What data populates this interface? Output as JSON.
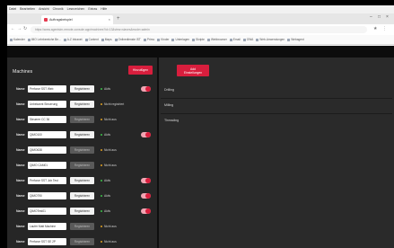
{
  "browser": {
    "menu": [
      "Datei",
      "Bearbeiten",
      "Ansicht",
      "Chronik",
      "Lesezeichen",
      "Extras",
      "Hilfe"
    ],
    "tab_title": "Auftragsbeispiel",
    "new_tab": "+",
    "close": "×",
    "window_controls": [
      "–",
      "□",
      "×"
    ],
    "url": "https://www.agentsim-remote-console.app/machines?id=13&view=slaves&mode=admin",
    "bookmarks": [
      "Kalender",
      "IMO Lehrbereiche Be...",
      "A-Z Intranet",
      "Content",
      "Maps",
      "Onlinedienste IST",
      "Primo",
      "Kinder",
      "Unterlagen",
      "Skripte",
      "Webbrowser",
      "Email",
      "OWA",
      "Web-Anwendungen",
      "Webagent"
    ]
  },
  "machines": {
    "title": "Machines",
    "add_button": "Hinzufügen",
    "label": "Name",
    "rows": [
      {
        "name": "Perforce SST Web",
        "register": "Registrieren",
        "register_state": "active",
        "status": "Aktiv",
        "status_color": "#3cc24a",
        "toggle": true
      },
      {
        "name": "Unbekannt Steuerung",
        "register": "Registrieren",
        "register_state": "active",
        "status": "Nicht registriert",
        "status_color": "#e0a020",
        "toggle": false
      },
      {
        "name": "Steuerer CC 36",
        "register": "Registrieren",
        "register_state": "disabled",
        "status": "Nicht aus",
        "status_color": "#e0a020",
        "toggle": false
      },
      {
        "name": "QIMO100",
        "register": "Registrieren",
        "register_state": "active",
        "status": "Aktiv",
        "status_color": "#3cc24a",
        "toggle": true
      },
      {
        "name": "QIMO638",
        "register": "Registrieren",
        "register_state": "disabled",
        "status": "Nicht aus",
        "status_color": "#e0a020",
        "toggle": false
      },
      {
        "name": "QIMO CAM01",
        "register": "Registrieren",
        "register_state": "disabled",
        "status": "Nicht aus",
        "status_color": "#e0a020",
        "toggle": false
      },
      {
        "name": "Perforce SST Job Test",
        "register": "Registrieren",
        "register_state": "active",
        "status": "Aktiv",
        "status_color": "#3cc24a",
        "toggle": true
      },
      {
        "name": "QIMO790",
        "register": "Registrieren",
        "register_state": "active",
        "status": "Aktiv",
        "status_color": "#3cc24a",
        "toggle": true
      },
      {
        "name": "QIMOTest01",
        "register": "Registrieren",
        "register_state": "active",
        "status": "Aktiv",
        "status_color": "#3cc24a",
        "toggle": true
      },
      {
        "name": "Laufer Matt Machine",
        "register": "Registrieren",
        "register_state": "disabled",
        "status": "Nicht aus",
        "status_color": "#e0a020",
        "toggle": false
      },
      {
        "name": "Perforce SST SE 2P",
        "register": "Registrieren",
        "register_state": "disabled",
        "status": "Nicht aus",
        "status_color": "#e0a020",
        "toggle": false
      }
    ]
  },
  "slaves": {
    "add_button_line1": "Add",
    "add_button_line2": "Einstellungen",
    "sections": [
      "Drilling",
      "Milling",
      "Threading"
    ]
  }
}
